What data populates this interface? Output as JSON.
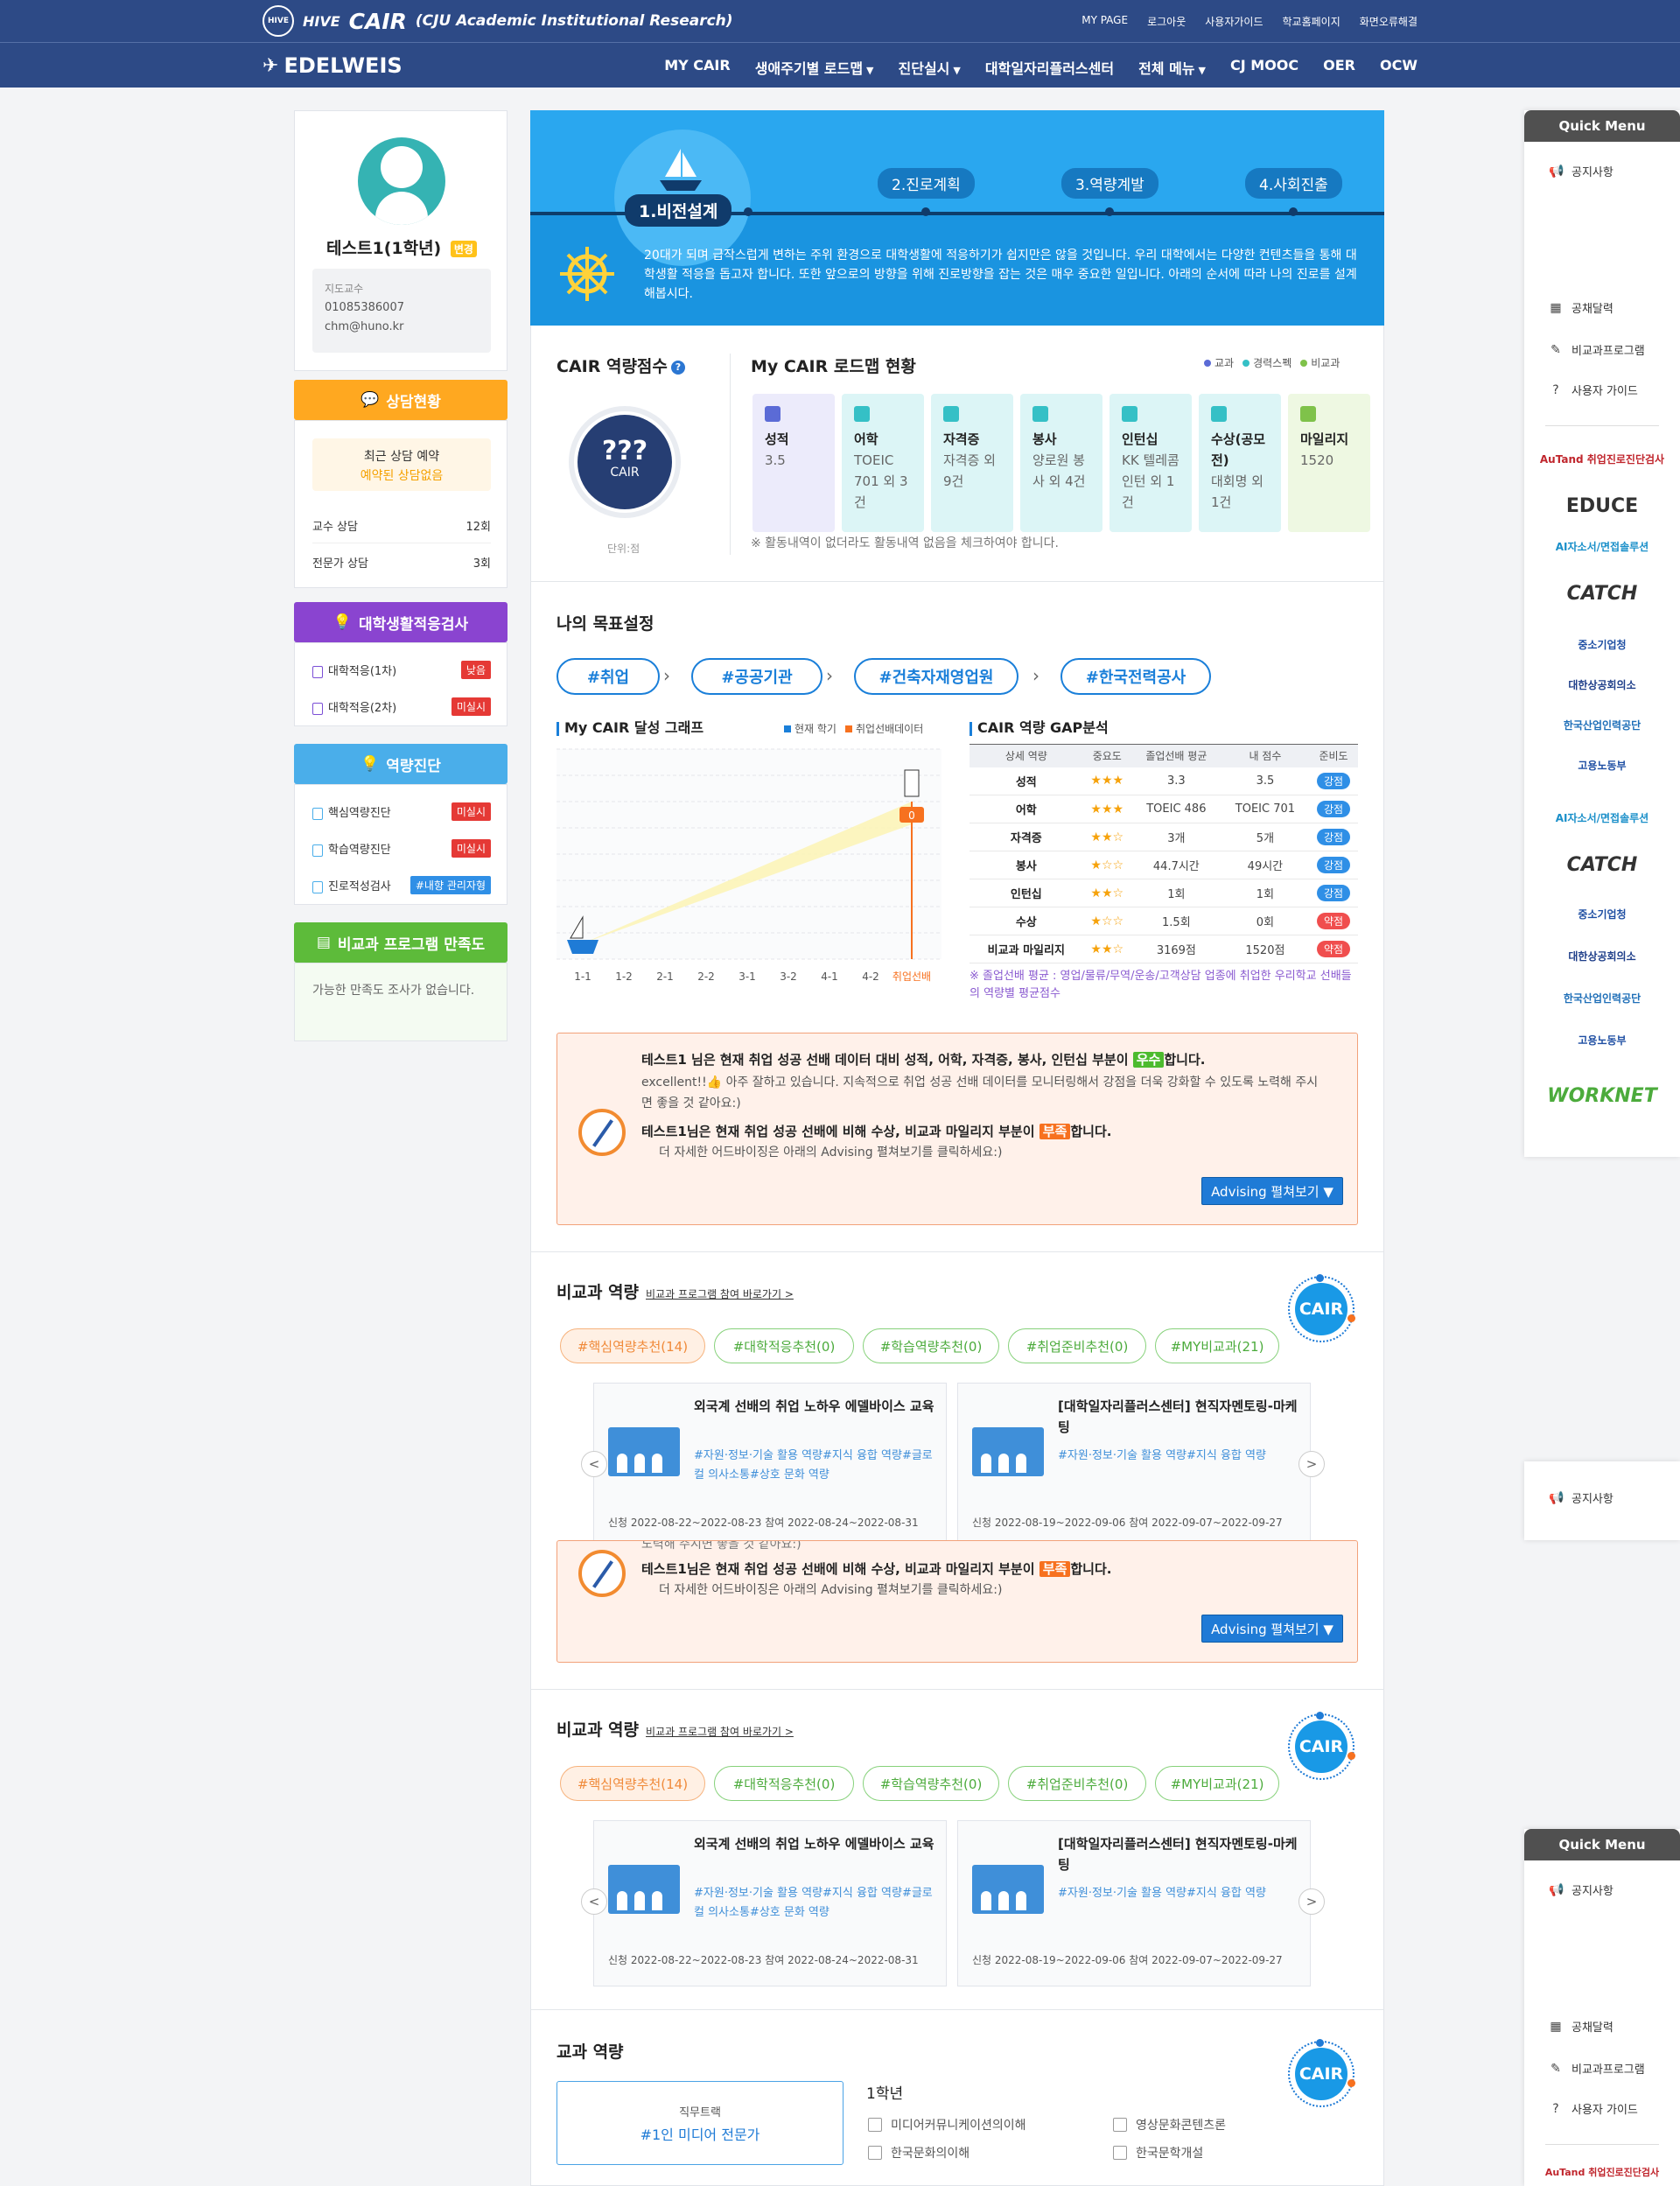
{
  "header": {
    "hive": "HIVE",
    "cair": "CAIR",
    "cair_sub": "(CJU Academic Institutional Research)",
    "seal": "HIVE",
    "top_links": [
      "MY PAGE",
      "로그아웃",
      "사용자가이드",
      "학교홈페이지",
      "화면오류해결"
    ],
    "edelweis": "EDELWEIS",
    "nav": [
      {
        "label": "MY CAIR",
        "caret": false
      },
      {
        "label": "생애주기별 로드맵",
        "caret": true
      },
      {
        "label": "진단실시",
        "caret": true
      },
      {
        "label": "대학일자리플러스센터",
        "caret": false
      },
      {
        "label": "전체 메뉴",
        "caret": true
      },
      {
        "label": "CJ MOOC",
        "caret": false
      },
      {
        "label": "OER",
        "caret": false
      },
      {
        "label": "OCW",
        "caret": false
      }
    ]
  },
  "profile": {
    "name": "테스트1(1학년)",
    "change": "변경",
    "advisor_label": "지도교수",
    "phone": "01085386007",
    "email": "chm@huno.kr"
  },
  "consult": {
    "title": "상담현황",
    "recent": "최근 상담 예약",
    "none": "예약된 상담없음",
    "rows": [
      {
        "label": "교수 상담",
        "value": "12회"
      },
      {
        "label": "전문가 상담",
        "value": "3회"
      }
    ]
  },
  "adapt": {
    "title": "대학생활적응검사",
    "rows": [
      {
        "label": "대학적응(1차)",
        "badge": "낮음"
      },
      {
        "label": "대학적응(2차)",
        "badge": "미실시"
      }
    ]
  },
  "diag": {
    "title": "역량진단",
    "rows": [
      {
        "label": "핵심역량진단",
        "badge": "미실시"
      },
      {
        "label": "학습역량진단",
        "badge": "미실시"
      },
      {
        "label": "진로적성검사",
        "badge": "#내향 관리자형"
      }
    ]
  },
  "satisfaction": {
    "title": "비교과 프로그램 만족도",
    "text": "가능한 만족도 조사가 없습니다."
  },
  "hero": {
    "steps": [
      "1.비전설계",
      "2.진로계획",
      "3.역량계발",
      "4.사회진출"
    ],
    "text": "20대가 되며 급작스럽게 변하는 주위 환경으로 대학생활에 적응하기가 쉽지만은 않을 것입니다. 우리 대학에서는 다양한 컨텐츠들을 통해 대학생활 적응을 돕고자 합니다. 또한 앞으로의 방향을 위해 진로방향을 잡는 것은 매우 중요한 일입니다. 아래의 순서에 따라 나의 진로를 설계해봅시다."
  },
  "score": {
    "title": "CAIR 역량점수",
    "value": "???",
    "label": "CAIR",
    "unit": "단위:점"
  },
  "roadmap": {
    "title": "My CAIR 로드맵 현황",
    "legend": [
      {
        "label": "교과",
        "color": "#5b6bd6"
      },
      {
        "label": "경력스펙",
        "color": "#35c0c6"
      },
      {
        "label": "비교과",
        "color": "#7fc24a"
      }
    ],
    "cards": [
      {
        "title": "성적",
        "value": "3.5",
        "bg": "#ecebfb",
        "icon": "#5b6bd6",
        "icon_name": "pencil-icon"
      },
      {
        "title": "어학",
        "value": "TOEIC 701 외 3건",
        "bg": "#dcf5f6",
        "icon": "#35c0c6",
        "icon_name": "globe-icon"
      },
      {
        "title": "자격증",
        "value": "자격증 외 9건",
        "bg": "#dcf5f6",
        "icon": "#35c0c6",
        "icon_name": "certificate-icon"
      },
      {
        "title": "봉사",
        "value": "양로원 봉사 외 4건",
        "bg": "#dcf5f6",
        "icon": "#35c0c6",
        "icon_name": "volunteer-icon"
      },
      {
        "title": "인턴십",
        "value": "KK 텔레콤 인턴 외 1건",
        "bg": "#dcf5f6",
        "icon": "#35c0c6",
        "icon_name": "briefcase-icon"
      },
      {
        "title": "수상(공모전)",
        "value": "대회명 외 1건",
        "bg": "#dcf5f6",
        "icon": "#35c0c6",
        "icon_name": "award-icon"
      },
      {
        "title": "마일리지",
        "value": "1520",
        "bg": "#eef8e2",
        "icon": "#7fc24a",
        "icon_name": "mileage-icon"
      }
    ],
    "note": "※ 활동내역이 없더라도 활동내역 없음을 체크하여야 합니다."
  },
  "goals": {
    "title": "나의 목표설정",
    "chips": [
      "#취업",
      "#공공기관",
      "#건축자재영업원",
      "#한국전력공사"
    ]
  },
  "chart": {
    "title": "My CAIR 달성 그래프",
    "legend_current": "현재 학기",
    "legend_senior": "취업선배데이터",
    "marker": "0"
  },
  "chart_data": {
    "type": "line",
    "title": "My CAIR 달성 그래프",
    "categories": [
      "1-1",
      "1-2",
      "2-1",
      "2-2",
      "3-1",
      "3-2",
      "4-1",
      "4-2",
      "취업선배"
    ],
    "series": [
      {
        "name": "현재 학기",
        "values": [
          0,
          null,
          null,
          null,
          null,
          null,
          null,
          null,
          null
        ]
      },
      {
        "name": "취업선배데이터",
        "values": [
          null,
          null,
          null,
          null,
          null,
          null,
          null,
          null,
          0
        ]
      }
    ],
    "grid": true,
    "legend": "top-right"
  },
  "gap": {
    "title": "CAIR 역량 GAP분석",
    "headers": [
      "상세 역량",
      "중요도",
      "졸업선배 평균",
      "내 점수",
      "준비도"
    ],
    "rows": [
      {
        "name": "성적",
        "stars": "★★★",
        "avg": "3.3",
        "mine": "3.5",
        "status": "강점",
        "good": true
      },
      {
        "name": "어학",
        "stars": "★★★",
        "avg": "TOEIC 486",
        "mine": "TOEIC 701",
        "status": "강점",
        "good": true
      },
      {
        "name": "자격증",
        "stars": "★★☆",
        "avg": "3개",
        "mine": "5개",
        "status": "강점",
        "good": true
      },
      {
        "name": "봉사",
        "stars": "★☆☆",
        "avg": "44.7시간",
        "mine": "49시간",
        "status": "강점",
        "good": true
      },
      {
        "name": "인턴십",
        "stars": "★★☆",
        "avg": "1회",
        "mine": "1회",
        "status": "강점",
        "good": true
      },
      {
        "name": "수상",
        "stars": "★☆☆",
        "avg": "1.5회",
        "mine": "0회",
        "status": "약점",
        "good": false
      },
      {
        "name": "비교과 마일리지",
        "stars": "★★☆",
        "avg": "3169점",
        "mine": "1520점",
        "status": "약점",
        "good": false
      }
    ],
    "note": "※ 졸업선배 평균 : 영업/물류/무역/운송/고객상담 업종에 취업한 우리학교 선배들의 역량별 평균점수"
  },
  "advice": {
    "l1a": "테스트1 님은 현재 취업 성공 선배 데이터 대비 성적, 어학, 자격증, 봉사, 인턴십 부분이 ",
    "l1tag": "우수",
    "l1b": "합니다.",
    "l2": "excellent!!👍 아주 잘하고 있습니다. 지속적으로 취업 성공 선배 데이터를 모니터링해서 강점을 더욱 강화할 수 있도록 노력해 주시면 좋을 것 같아요:)",
    "l3a": "테스트1님은 현재 취업 성공 선배에 비해 수상, 비교과 마일리지 부분이 ",
    "l3tag": "부족",
    "l3b": "합니다.",
    "l4": "더 자세한 어드바이징은 아래의 Advising 펼쳐보기를 클릭하세요:)",
    "button": "Advising 펼쳐보기 ▼",
    "overlap": "노력해 주시면 좋을 것 같아요:)"
  },
  "extra": {
    "title": "비교과 역량",
    "link": "비교과 프로그램 참여 바로가기",
    "link_arrow": ">",
    "badge": "CAIR",
    "chips": [
      "#핵심역량추천(14)",
      "#대학적응추천(0)",
      "#학습역량추천(0)",
      "#취업준비추천(0)",
      "#MY비교과(21)"
    ],
    "programs": [
      {
        "title": "외국계 선배의 취업 노하우 에델바이스 교육",
        "tags": "#자원·정보·기술 활용 역량#지식 융합 역량#글로컬 의사소통#상호 문화 역량",
        "dates": "신청 2022-08-22~2022-08-23 참여 2022-08-24~2022-08-31"
      },
      {
        "title": "[대학일자리플러스센터] 현직자멘토링-마케팅",
        "tags": "#자원·정보·기술 활용 역량#지식 융합 역량",
        "dates": "신청 2022-08-19~2022-09-06 참여 2022-09-07~2022-09-27"
      }
    ],
    "prev": "<",
    "next": ">"
  },
  "course": {
    "title": "교과 역량",
    "track_label": "직무트랙",
    "track": "#1인 미디어 전문가",
    "year": "1학년",
    "items": [
      "미디어커뮤니케이션의이해",
      "영상문화콘텐츠론",
      "한국문화의이해",
      "한국문학개설"
    ]
  },
  "quick": {
    "title": "Quick Menu",
    "items": [
      "공지사항",
      "공채달력",
      "비교과프로그램",
      "사용자 가이드"
    ],
    "logos": [
      {
        "text": "AuTand 취업진로진단검사",
        "color": "#c0262d"
      },
      {
        "text": "EDUCE",
        "color": "#333333"
      },
      {
        "text": "AI자소서/면접솔루션",
        "color": "#1a8fc9"
      },
      {
        "text": "CATCH",
        "color": "#333333"
      },
      {
        "text": "중소기업청",
        "color": "#1f4fa3"
      },
      {
        "text": "대한상공회의소",
        "color": "#1f3f8a"
      },
      {
        "text": "한국산업인력공단",
        "color": "#1f6fb8"
      },
      {
        "text": "고용노동부",
        "color": "#1f4fa3"
      },
      {
        "text": "AI자소서/면접솔루션",
        "color": "#1a8fc9"
      },
      {
        "text": "CATCH",
        "color": "#333333"
      },
      {
        "text": "중소기업청",
        "color": "#1f4fa3"
      },
      {
        "text": "대한상공회의소",
        "color": "#1f3f8a"
      },
      {
        "text": "한국산업인력공단",
        "color": "#1f6fb8"
      },
      {
        "text": "고용노동부",
        "color": "#1f4fa3"
      },
      {
        "text": "WORKNET",
        "color": "#4cab3c"
      }
    ]
  },
  "colors": {
    "navy": "#2d4a86",
    "orange": "#ffa820",
    "purple": "#8a44d0",
    "sky": "#4aaeea",
    "green": "#5dbb3a"
  }
}
